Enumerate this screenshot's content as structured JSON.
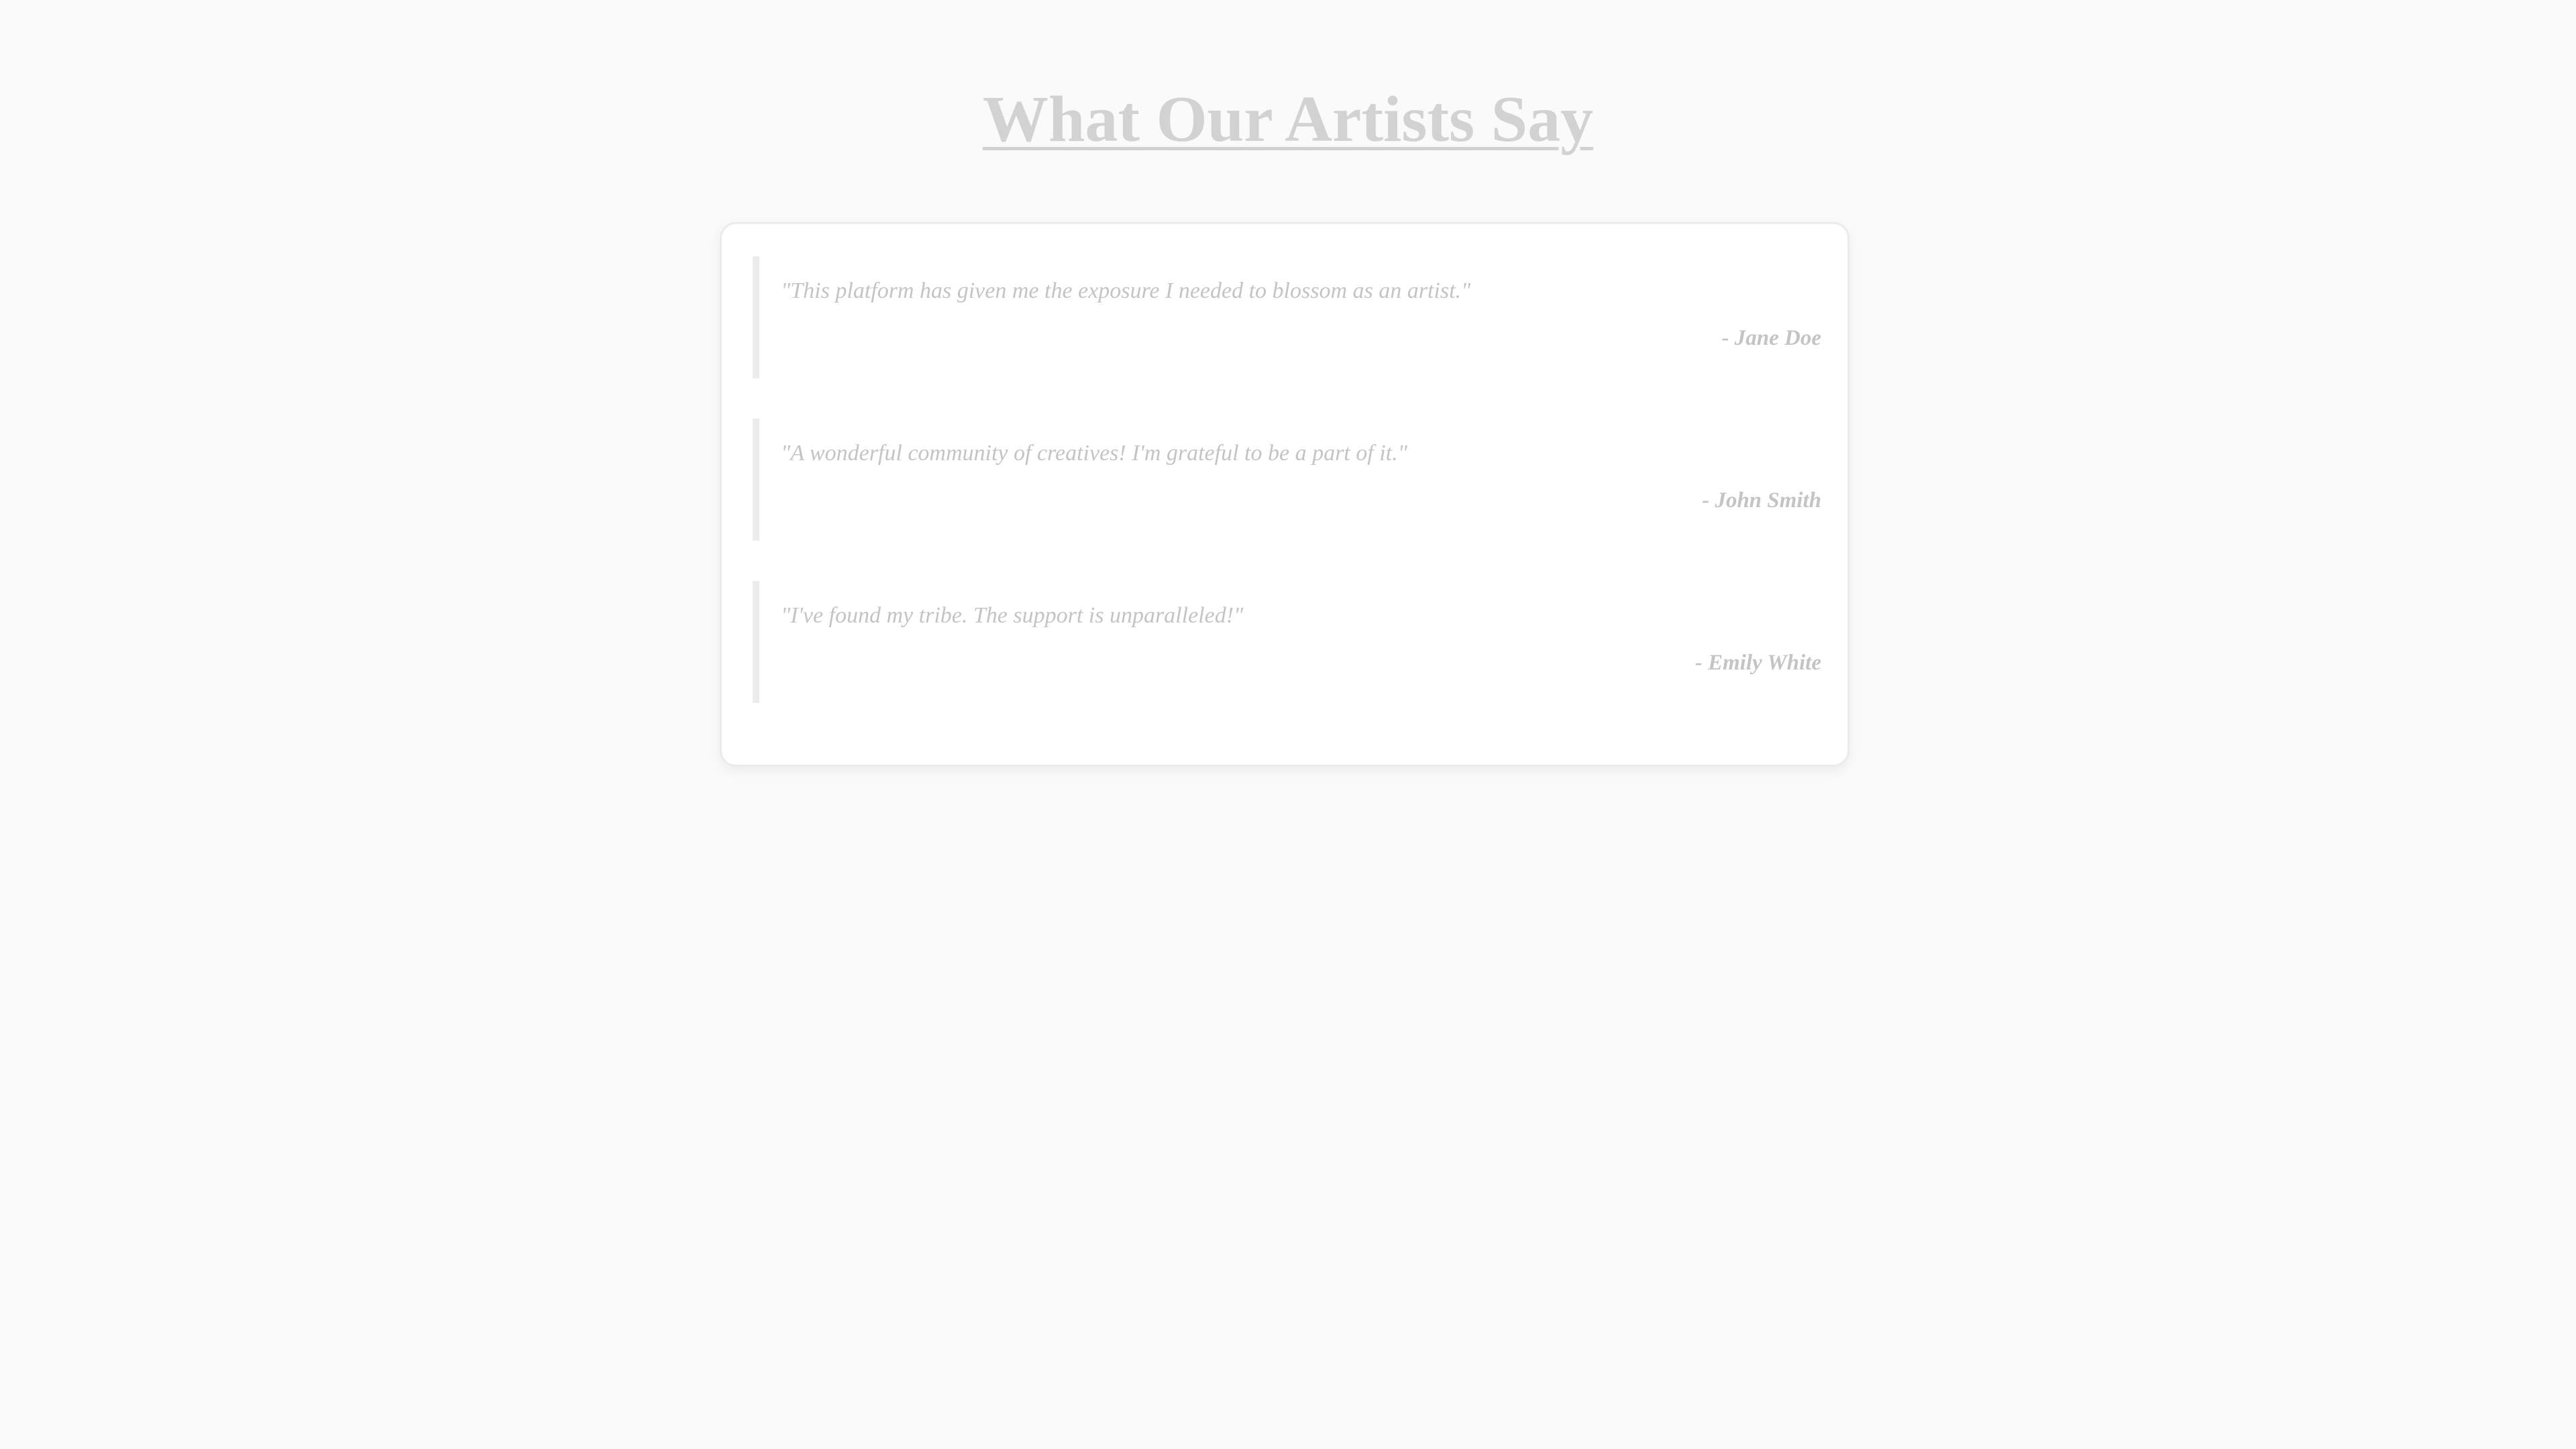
{
  "page": {
    "title": "What Our Artists Say"
  },
  "testimonials": [
    {
      "quote": "\"This platform has given me the exposure I needed to blossom as an artist.\"",
      "author": "- Jane Doe"
    },
    {
      "quote": "\"A wonderful community of creatives! I'm grateful to be a part of it.\"",
      "author": "- John Smith"
    },
    {
      "quote": "\"I've found my tribe. The support is unparalleled!\"",
      "author": "- Emily White"
    }
  ],
  "colors": {
    "background": "#fafafa",
    "card": "#ffffff",
    "text": "#c4c4c4",
    "title": "#d2d2d2",
    "accent_border": "#ececec"
  }
}
